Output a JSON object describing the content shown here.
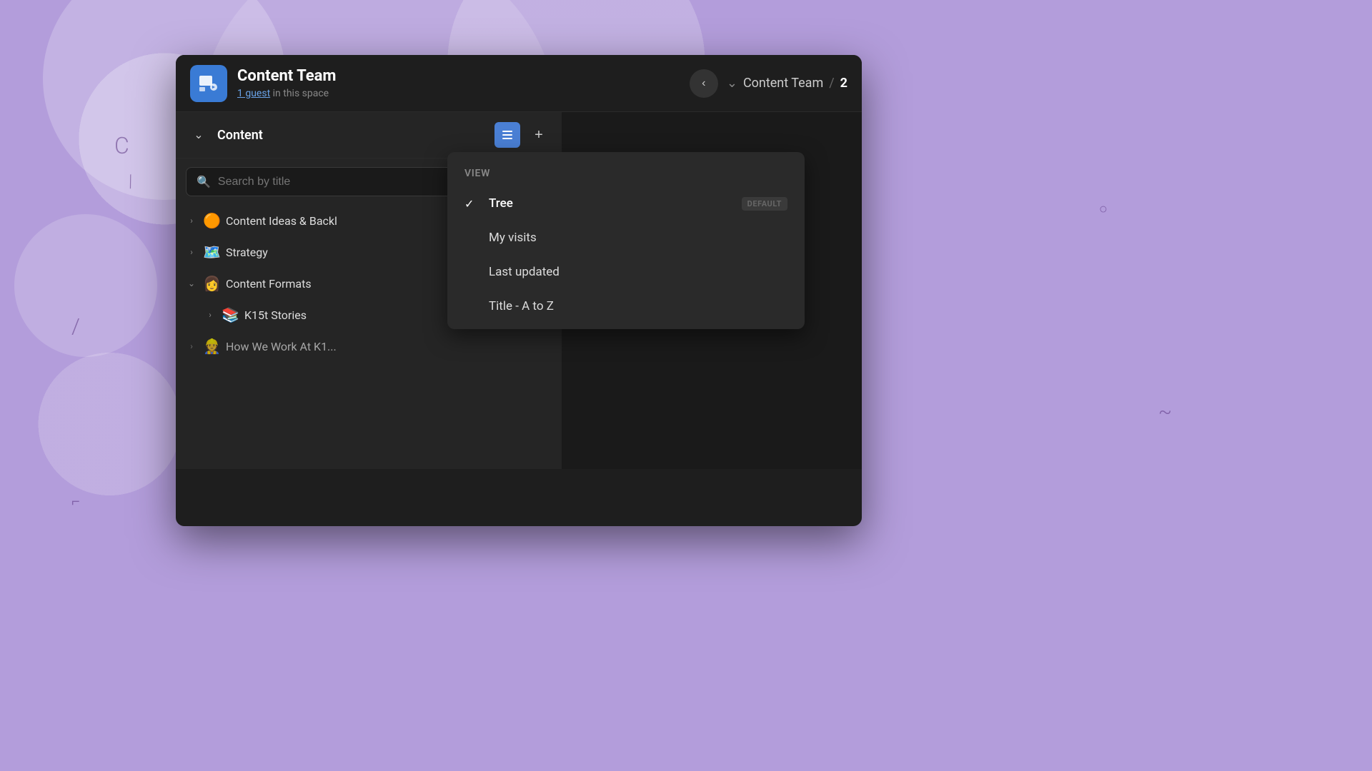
{
  "background": {
    "color": "#b39ddb"
  },
  "window": {
    "title": "Content Team"
  },
  "header": {
    "space_icon": "🖥",
    "title": "Content Team",
    "subtitle_prefix": "1 guest",
    "subtitle_suffix": " in this space",
    "back_button_label": "‹",
    "breadcrumb_chevron": "⌄",
    "breadcrumb_space": "Content Team",
    "breadcrumb_sep": "/",
    "breadcrumb_num": "2"
  },
  "sidebar": {
    "content_label": "Content",
    "search_placeholder": "Search by title",
    "add_button_label": "+",
    "tree_items": [
      {
        "id": "content-ideas",
        "chevron": "›",
        "emoji": "🟠",
        "label": "Content Ideas & Backl",
        "indent": 0
      },
      {
        "id": "strategy",
        "chevron": "›",
        "emoji": "🗺",
        "label": "Strategy",
        "indent": 0
      },
      {
        "id": "content-formats",
        "chevron": "⌄",
        "emoji": "👩",
        "label": "Content Formats",
        "indent": 0
      },
      {
        "id": "k15t-stories",
        "chevron": "›",
        "emoji": "📚",
        "label": "K15t Stories",
        "indent": 1
      },
      {
        "id": "how-we-work",
        "chevron": "›",
        "emoji": "👷",
        "label": "How We Work At K1...",
        "indent": 0,
        "faded": true
      }
    ]
  },
  "dropdown": {
    "section_label": "View",
    "items": [
      {
        "id": "tree",
        "label": "Tree",
        "active": true,
        "badge": "DEFAULT"
      },
      {
        "id": "my-visits",
        "label": "My visits",
        "active": false,
        "badge": ""
      },
      {
        "id": "last-updated",
        "label": "Last updated",
        "active": false,
        "badge": ""
      },
      {
        "id": "title-a-to-z",
        "label": "Title - A to Z",
        "active": false,
        "badge": ""
      }
    ]
  }
}
